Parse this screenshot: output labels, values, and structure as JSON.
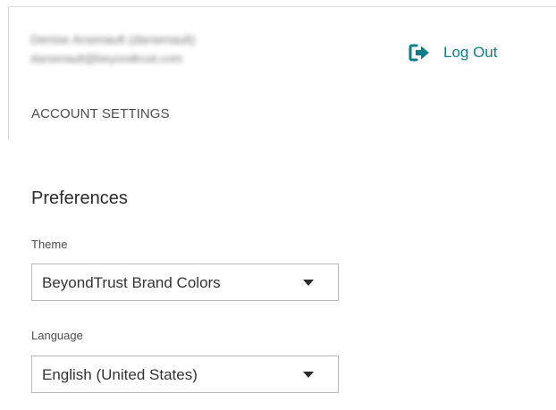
{
  "user": {
    "name": "Denise Arsenault (darsenault)",
    "email": "darsenault@beyondtrust.com"
  },
  "header": {
    "logout_label": "Log Out",
    "logout_icon": "sign-out-icon",
    "account_settings": "ACCOUNT SETTINGS"
  },
  "preferences": {
    "title": "Preferences",
    "theme": {
      "label": "Theme",
      "value": "BeyondTrust Brand Colors"
    },
    "language": {
      "label": "Language",
      "value": "English (United States)"
    }
  },
  "colors": {
    "accent": "#0d7e8a",
    "text": "#333333",
    "border": "#b8b8b8"
  }
}
